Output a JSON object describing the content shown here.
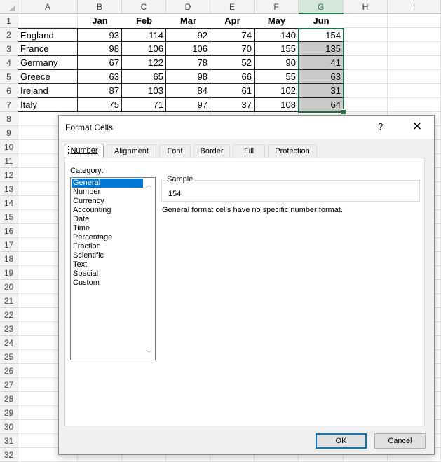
{
  "sheet": {
    "columns": [
      "A",
      "B",
      "C",
      "D",
      "E",
      "F",
      "G",
      "H",
      "I"
    ],
    "rows": [
      "1",
      "2",
      "3",
      "4",
      "5",
      "6",
      "7",
      "8",
      "9",
      "10",
      "11",
      "12",
      "13",
      "14",
      "15",
      "16",
      "17",
      "18",
      "19",
      "20",
      "21",
      "22",
      "23",
      "24",
      "25",
      "26",
      "27",
      "28",
      "29",
      "30",
      "31",
      "32"
    ],
    "header_row": [
      "",
      "Jan",
      "Feb",
      "Mar",
      "Apr",
      "May",
      "Jun"
    ],
    "data": [
      {
        "country": "England",
        "values": [
          "93",
          "114",
          "92",
          "74",
          "140",
          "154"
        ]
      },
      {
        "country": "France",
        "values": [
          "98",
          "106",
          "106",
          "70",
          "155",
          "135"
        ]
      },
      {
        "country": "Germany",
        "values": [
          "67",
          "122",
          "78",
          "52",
          "90",
          "41"
        ]
      },
      {
        "country": "Greece",
        "values": [
          "63",
          "65",
          "98",
          "66",
          "55",
          "63"
        ]
      },
      {
        "country": "Ireland",
        "values": [
          "87",
          "103",
          "84",
          "61",
          "102",
          "31"
        ]
      },
      {
        "country": "Italy",
        "values": [
          "75",
          "71",
          "97",
          "37",
          "108",
          "64"
        ]
      }
    ],
    "selected_column": "G",
    "accent_color": "#1e7145"
  },
  "dialog": {
    "title": "Format Cells",
    "help_label": "?",
    "close_label": "✕",
    "tabs": [
      "Number",
      "Alignment",
      "Font",
      "Border",
      "Fill",
      "Protection"
    ],
    "active_tab": "Number",
    "category_label_prefix": "C",
    "category_label_rest": "ategory:",
    "categories": [
      "General",
      "Number",
      "Currency",
      "Accounting",
      "Date",
      "Time",
      "Percentage",
      "Fraction",
      "Scientific",
      "Text",
      "Special",
      "Custom"
    ],
    "selected_category": "General",
    "sample_label": "Sample",
    "sample_value": "154",
    "description": "General format cells have no specific number format.",
    "ok_label": "OK",
    "cancel_label": "Cancel",
    "accent_color": "#0078d7"
  }
}
